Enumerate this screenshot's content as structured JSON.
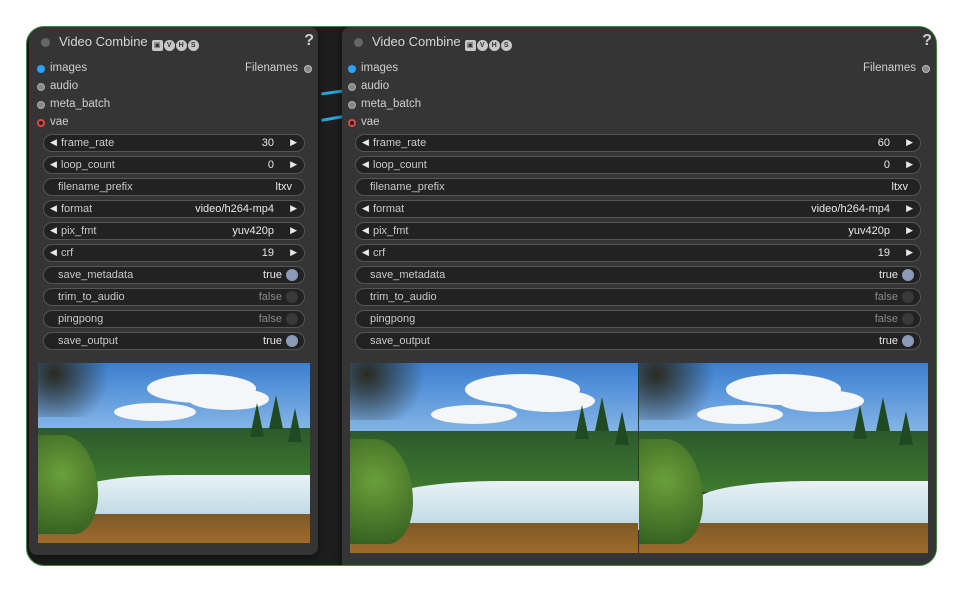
{
  "nodes": {
    "left": {
      "title": "Video Combine",
      "badge_icons": [
        "camera-icon",
        "V",
        "H",
        "S"
      ],
      "help": "?",
      "inputs": [
        "images",
        "audio",
        "meta_batch",
        "vae"
      ],
      "output": "Filenames",
      "widgets": {
        "frame_rate": {
          "label": "frame_rate",
          "value": "30"
        },
        "loop_count": {
          "label": "loop_count",
          "value": "0"
        },
        "filename_prefix": {
          "label": "filename_prefix",
          "value": "ltxv"
        },
        "format": {
          "label": "format",
          "value": "video/h264-mp4"
        },
        "pix_fmt": {
          "label": "pix_fmt",
          "value": "yuv420p"
        },
        "crf": {
          "label": "crf",
          "value": "19"
        },
        "save_metadata": {
          "label": "save_metadata",
          "value": "true"
        },
        "trim_to_audio": {
          "label": "trim_to_audio",
          "value": "false"
        },
        "pingpong": {
          "label": "pingpong",
          "value": "false"
        },
        "save_output": {
          "label": "save_output",
          "value": "true"
        }
      }
    },
    "right": {
      "title": "Video Combine",
      "badge_icons": [
        "camera-icon",
        "V",
        "H",
        "S"
      ],
      "help": "?",
      "inputs": [
        "images",
        "audio",
        "meta_batch",
        "vae"
      ],
      "output": "Filenames",
      "widgets": {
        "frame_rate": {
          "label": "frame_rate",
          "value": "60"
        },
        "loop_count": {
          "label": "loop_count",
          "value": "0"
        },
        "filename_prefix": {
          "label": "filename_prefix",
          "value": "ltxv"
        },
        "format": {
          "label": "format",
          "value": "video/h264-mp4"
        },
        "pix_fmt": {
          "label": "pix_fmt",
          "value": "yuv420p"
        },
        "crf": {
          "label": "crf",
          "value": "19"
        },
        "save_metadata": {
          "label": "save_metadata",
          "value": "true"
        },
        "trim_to_audio": {
          "label": "trim_to_audio",
          "value": "false"
        },
        "pingpong": {
          "label": "pingpong",
          "value": "false"
        },
        "save_output": {
          "label": "save_output",
          "value": "true"
        }
      }
    }
  },
  "colors": {
    "canvas_bg": "#1e1e1e",
    "node_bg": "#353535",
    "image_socket": "#29a3ff",
    "vae_socket": "#e04848",
    "link": "#2aa8e0",
    "toggle_on": "#8a9bb8"
  }
}
